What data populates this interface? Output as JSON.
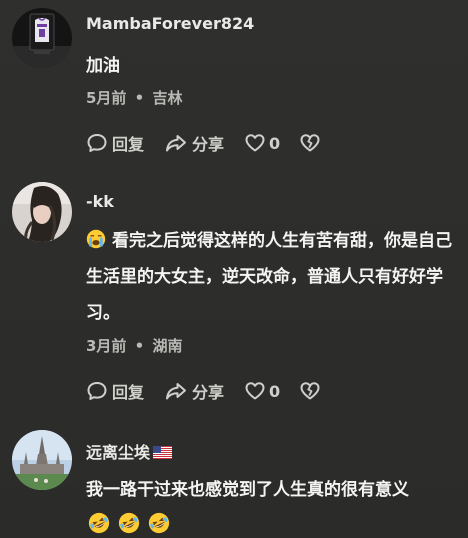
{
  "comments": [
    {
      "username": "MambaForever824",
      "text": "加油",
      "time": "5月前",
      "location": "吉林",
      "reply_label": "回复",
      "share_label": "分享",
      "likes": "0"
    },
    {
      "username": "-kk",
      "text": "看完之后觉得这样的人生有苦有甜，你是自己生活里的大女主，逆天改命，普通人只有好好学习。",
      "time": "3月前",
      "location": "湖南",
      "reply_label": "回复",
      "share_label": "分享",
      "likes": "0"
    },
    {
      "username": "远离尘埃",
      "text": "我一路干过来也感觉到了人生真的很有意义"
    }
  ],
  "meta_separator": "•",
  "icons": {
    "reply": "comment-bubble-icon",
    "share": "share-arrow-icon",
    "like": "heart-outline-icon",
    "dislike": "broken-heart-icon",
    "emoji_crying": "loudly-crying-face-emoji",
    "emoji_laughing": "rolling-on-floor-laughing-emoji",
    "flag": "us-flag-icon"
  },
  "colors": {
    "background": "#2d2e2c",
    "username": "#e9e9e6",
    "text": "#f4f4f2",
    "meta": "#b9b9b5",
    "action": "#cfcfcb"
  }
}
